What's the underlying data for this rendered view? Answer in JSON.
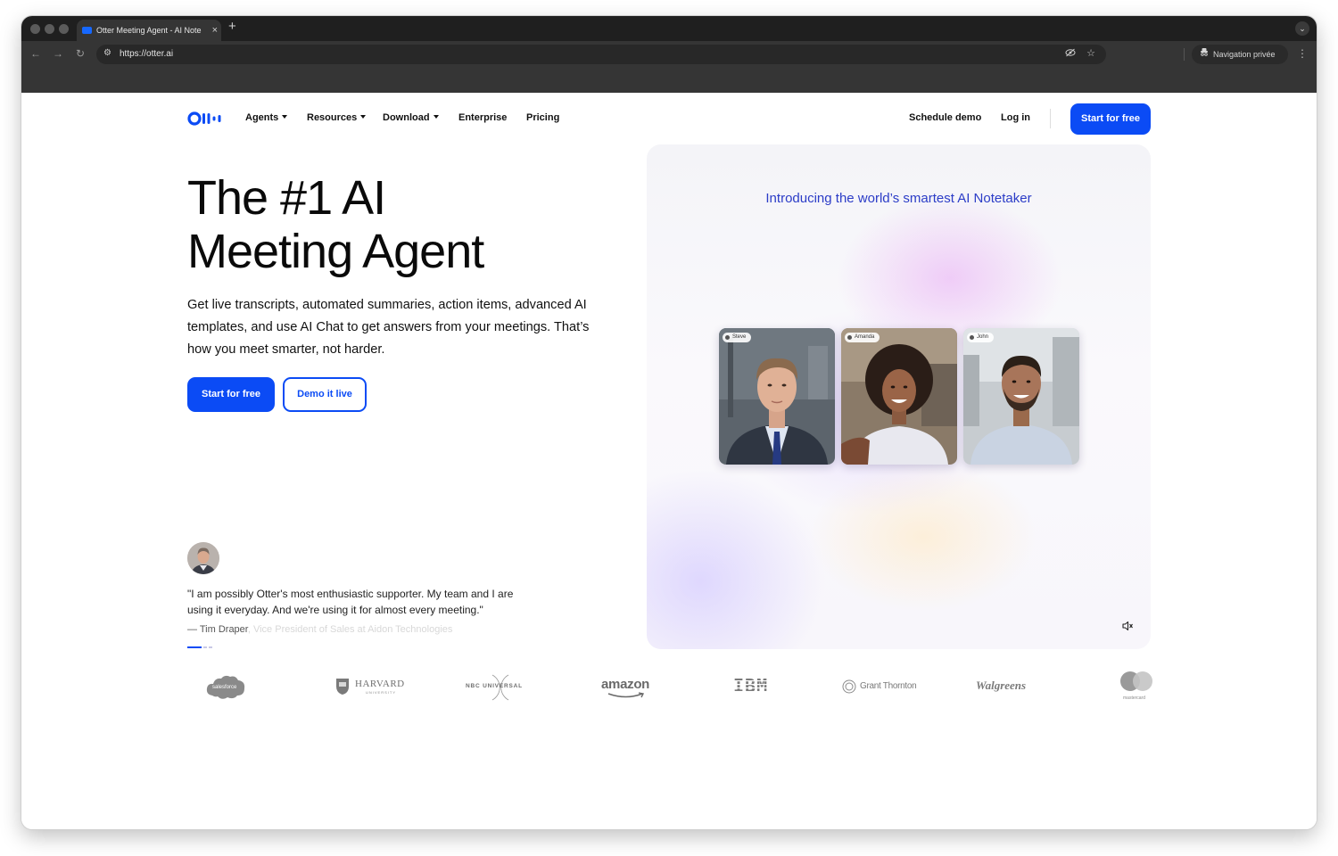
{
  "browser": {
    "tab_title": "Otter Meeting Agent - AI Note",
    "tab_close": "×",
    "new_tab": "+",
    "url": "https://otter.ai",
    "private_label": "Navigation privée"
  },
  "nav": {
    "items": [
      {
        "label": "Agents",
        "dropdown": true
      },
      {
        "label": "Resources",
        "dropdown": true
      },
      {
        "label": "Download",
        "dropdown": true
      },
      {
        "label": "Enterprise",
        "dropdown": false
      },
      {
        "label": "Pricing",
        "dropdown": false
      }
    ],
    "schedule_demo": "Schedule demo",
    "log_in": "Log in",
    "start_free": "Start for free"
  },
  "hero": {
    "title_line1": "The #1 AI",
    "title_line2": "Meeting Agent",
    "subtitle": "Get live transcripts, automated summaries, action items, advanced AI templates, and use AI Chat to get answers from your meetings. That’s how you meet smarter, not harder.",
    "cta_primary": "Start for free",
    "cta_secondary": "Demo it live"
  },
  "testimonial": {
    "quote": "\"I am possibly Otter's most enthusiastic supporter. My team and I are using it everyday. And we're using it for almost every meeting.\"",
    "author": "— Tim Draper",
    "author_title_faded": ", Vice President of Sales at Aidon Technologies"
  },
  "media": {
    "heading": "Introducing the world’s smartest AI Notetaker",
    "participants": [
      "Steve",
      "Amanda",
      "John"
    ]
  },
  "logos": [
    {
      "name": "salesforce",
      "text": "salesforce"
    },
    {
      "name": "harvard",
      "text": "HARVARD",
      "sub": "UNIVERSITY"
    },
    {
      "name": "nbc-universal",
      "text": "NBC UNIVERSAL"
    },
    {
      "name": "amazon",
      "text": "amazon"
    },
    {
      "name": "ibm",
      "text": "IBM"
    },
    {
      "name": "grant-thornton",
      "text": "Grant Thornton"
    },
    {
      "name": "walgreens",
      "text": "Walgreens"
    },
    {
      "name": "mastercard",
      "text": "mastercard"
    }
  ],
  "colors": {
    "brand_blue": "#0b4bf5",
    "media_heading": "#2b3cc7",
    "chrome_dark": "#1f1f1f",
    "chrome_toolbar": "#353535"
  }
}
